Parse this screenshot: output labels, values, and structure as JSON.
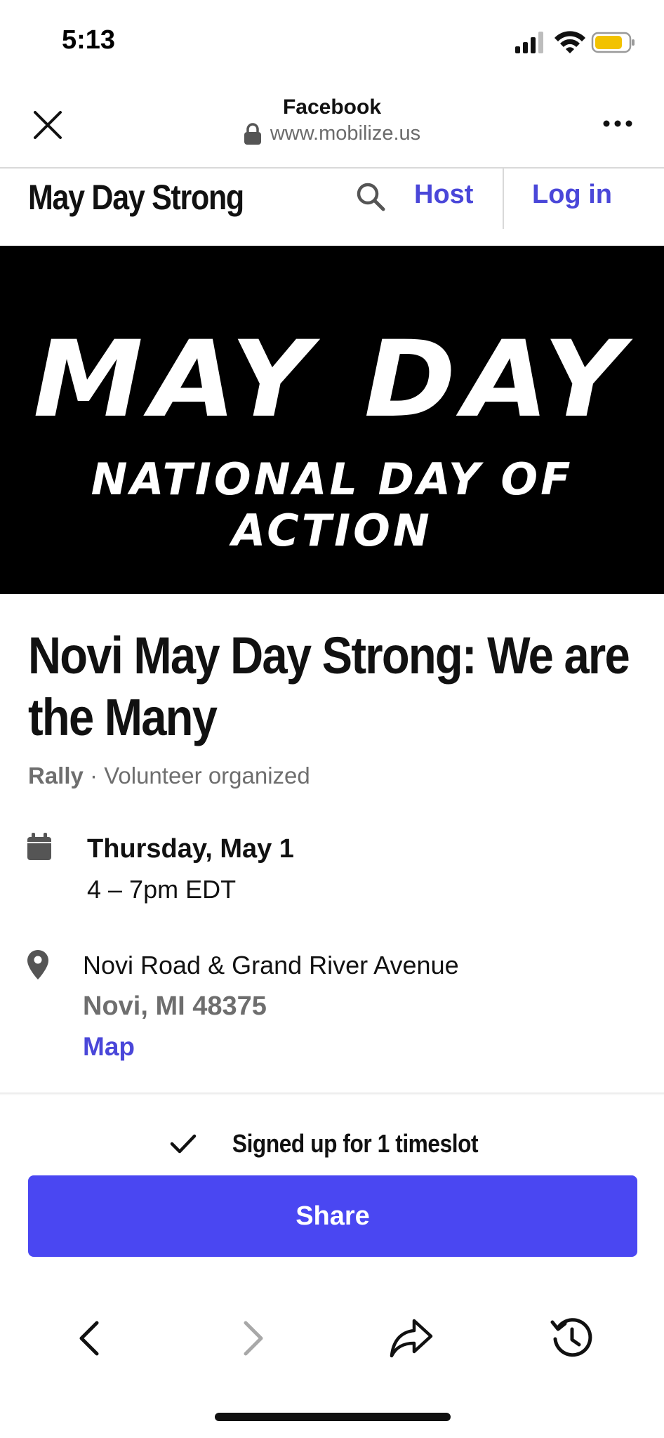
{
  "status_bar": {
    "time": "5:13"
  },
  "browser": {
    "app_title": "Facebook",
    "url": "www.mobilize.us",
    "icons": {
      "close": "close-icon",
      "lock": "lock-icon",
      "more": "more-icon"
    }
  },
  "site_nav": {
    "brand": "May Day Strong",
    "host_label": "Host",
    "login_label": "Log in",
    "accent_color": "#4a47d9"
  },
  "banner": {
    "line1": "MAY DAY",
    "line2": "NATIONAL DAY OF ACTION"
  },
  "event": {
    "title": "Novi May Day Strong: We are the Many",
    "type": "Rally",
    "separator": " · ",
    "organizer": "Volunteer organized",
    "date": "Thursday, May 1",
    "time": "4 – 7pm EDT",
    "address_line1": "Novi Road & Grand River Avenue",
    "address_line2": "Novi, MI 48375",
    "map_label": "Map"
  },
  "signup": {
    "status": "Signed up for 1 timeslot",
    "share_label": "Share",
    "share_color": "#4a47f2"
  },
  "toolbar": {
    "icons": [
      "back-icon",
      "forward-icon",
      "share-arrow-icon",
      "history-icon"
    ]
  }
}
